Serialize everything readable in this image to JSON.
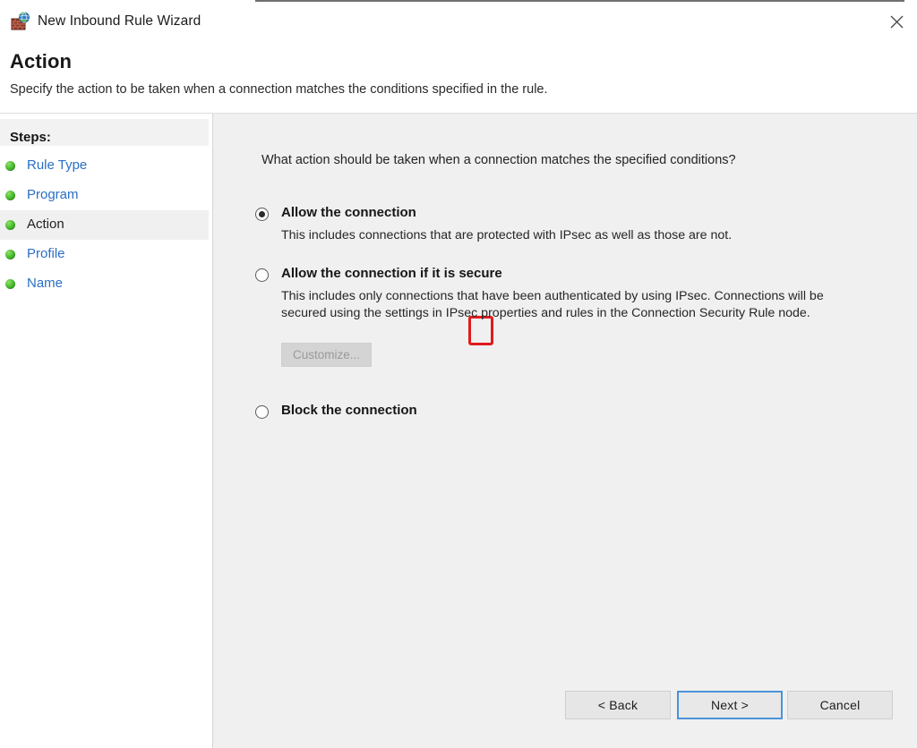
{
  "window": {
    "title": "New Inbound Rule Wizard",
    "icon": "firewall-globe-icon",
    "close_label": "close-icon"
  },
  "header": {
    "title": "Action",
    "subtitle": "Specify the action to be taken when a connection matches the conditions specified in the rule."
  },
  "sidebar": {
    "header": "Steps:",
    "items": [
      {
        "label": "Rule Type",
        "state": "completed"
      },
      {
        "label": "Program",
        "state": "completed"
      },
      {
        "label": "Action",
        "state": "current"
      },
      {
        "label": "Profile",
        "state": "completed"
      },
      {
        "label": "Name",
        "state": "completed"
      }
    ]
  },
  "main": {
    "prompt": "What action should be taken when a connection matches the specified conditions?",
    "options": [
      {
        "id": "allow",
        "title": "Allow the connection",
        "description": "This includes connections that are protected with IPsec as well as those are not.",
        "selected": true,
        "annotated": true
      },
      {
        "id": "allow-if-secure",
        "title": "Allow the connection if it is secure",
        "description": "This includes only connections that have been authenticated by using IPsec.  Connections will be secured using the settings in IPsec properties and rules in the Connection Security Rule node.",
        "selected": false,
        "annotated": false
      },
      {
        "id": "block",
        "title": "Block the connection",
        "description": "",
        "selected": false,
        "annotated": false
      }
    ],
    "customize_button": {
      "label": "Customize...",
      "enabled": false
    }
  },
  "footer": {
    "back_label": "< Back",
    "next_label": "Next >",
    "cancel_label": "Cancel",
    "default_button": "next"
  },
  "colors": {
    "link": "#2a6fc4",
    "annotation": "#e01b1b",
    "default_button_border": "#4b93d8",
    "pane_background": "#f0f0f0",
    "step_bullet": "#4cbd31"
  }
}
